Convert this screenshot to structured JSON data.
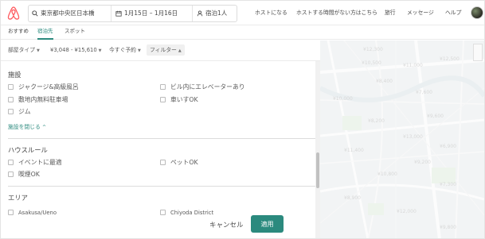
{
  "header": {
    "destination": "東京都中央区日本橋",
    "dates": "1月15日 – 1月16日",
    "guests": "宿泊1人",
    "nav": [
      "ホストになる",
      "ホストする時間がない方はこちら",
      "旅行",
      "メッセージ",
      "ヘルプ"
    ]
  },
  "tabs": [
    "おすすめ",
    "宿泊先",
    "スポット"
  ],
  "active_tab": "宿泊先",
  "filters": {
    "room_type": "部屋タイプ",
    "price": "¥3,048 - ¥15,610",
    "instant_book": "今すぐ予約",
    "more": "フィルター"
  },
  "panel": {
    "facilities_title": "施設",
    "facilities": [
      "ジャクージ&高級風呂",
      "ビル内にエレベーターあり",
      "敷地内無料駐車場",
      "車いすOK",
      "ジム"
    ],
    "close_facilities": "施設を閉じる",
    "house_rules_title": "ハウスルール",
    "house_rules": [
      "イベントに最適",
      "ペットOK",
      "喫煙OK"
    ],
    "area_title": "エリア",
    "areas": [
      "Asakusa/Ueno",
      "Chiyoda District"
    ],
    "cancel": "キャンセル",
    "apply": "適用"
  },
  "map": {
    "prices": [
      "¥12,300",
      "¥10,500",
      "¥11,000",
      "¥12,500",
      "¥8,400",
      "¥7,600",
      "¥10,000",
      "¥9,600",
      "¥8,200",
      "¥13,000",
      "¥6,900",
      "¥11,400",
      "¥9,200",
      "¥10,800",
      "¥7,300",
      "¥8,900",
      "¥12,000",
      "¥9,800"
    ]
  },
  "colors": {
    "accent": "#2b8a7e",
    "brand": "#ff5a5f"
  }
}
